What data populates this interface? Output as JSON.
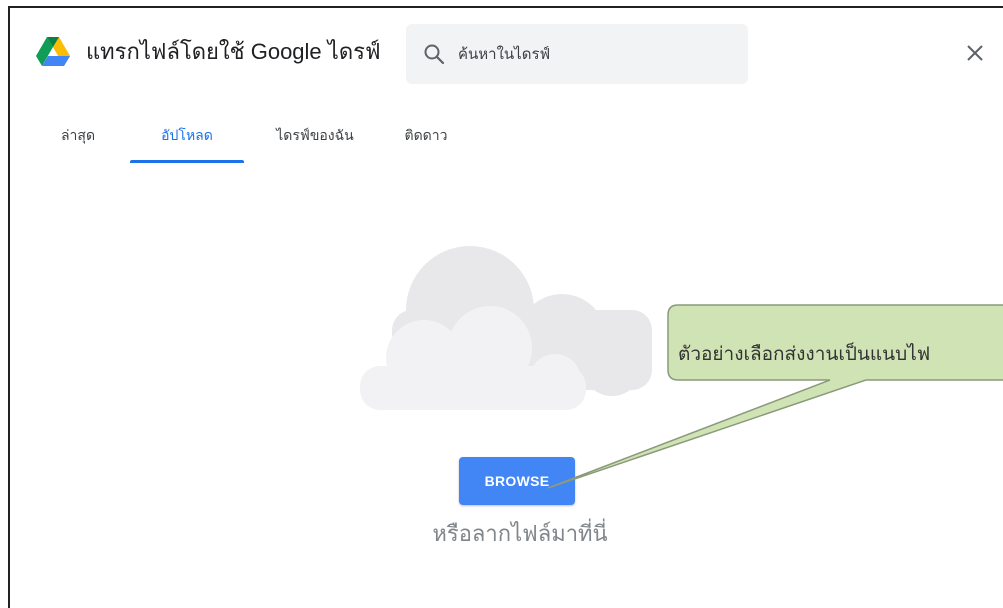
{
  "header": {
    "title": "แทรกไฟล์โดยใช้ Google ไดรฟ์",
    "logo_icon": "google-drive-icon",
    "close_icon": "close-icon"
  },
  "search": {
    "placeholder": "ค้นหาในไดรฟ์",
    "value": "",
    "icon": "search-icon"
  },
  "tabs": [
    {
      "label": "ล่าสุด",
      "active": false
    },
    {
      "label": "อัปโหลด",
      "active": true
    },
    {
      "label": "ไดรฟ์ของฉัน",
      "active": false
    },
    {
      "label": "ติดดาว",
      "active": false
    }
  ],
  "upload": {
    "illustration": "cloud-illustration",
    "browse_label": "BROWSE",
    "drop_text": "หรือลากไฟล์มาที่นี่"
  },
  "callout": {
    "text": "ตัวอย่างเลือกส่งงานเป็นแนบไฟ"
  },
  "colors": {
    "accent": "#1a73e8",
    "button": "#4285f4",
    "search_bg": "#f1f3f4",
    "cloud": "#e8e8ea",
    "callout_fill": "#cfe3b4",
    "callout_border": "#8a9a7a"
  }
}
